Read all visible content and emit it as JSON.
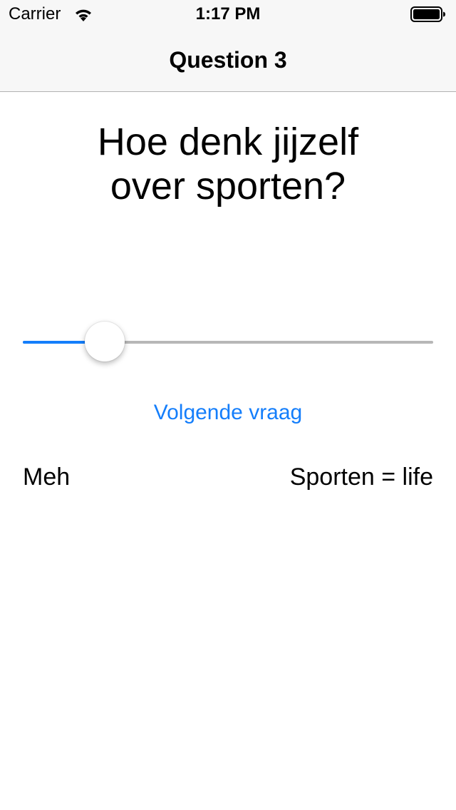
{
  "status_bar": {
    "carrier": "Carrier",
    "time": "1:17 PM",
    "wifi_icon": "wifi-icon",
    "battery_icon": "battery-icon"
  },
  "nav": {
    "title": "Question 3"
  },
  "question": {
    "line1": "Hoe denk jijzelf",
    "line2": "over sporten?"
  },
  "slider": {
    "value": 0.2,
    "accent_color": "#147efb",
    "track_color": "#b7b7b7"
  },
  "next_button": {
    "label": "Volgende vraag"
  },
  "scale_labels": {
    "min": "Meh",
    "max": "Sporten = life"
  }
}
